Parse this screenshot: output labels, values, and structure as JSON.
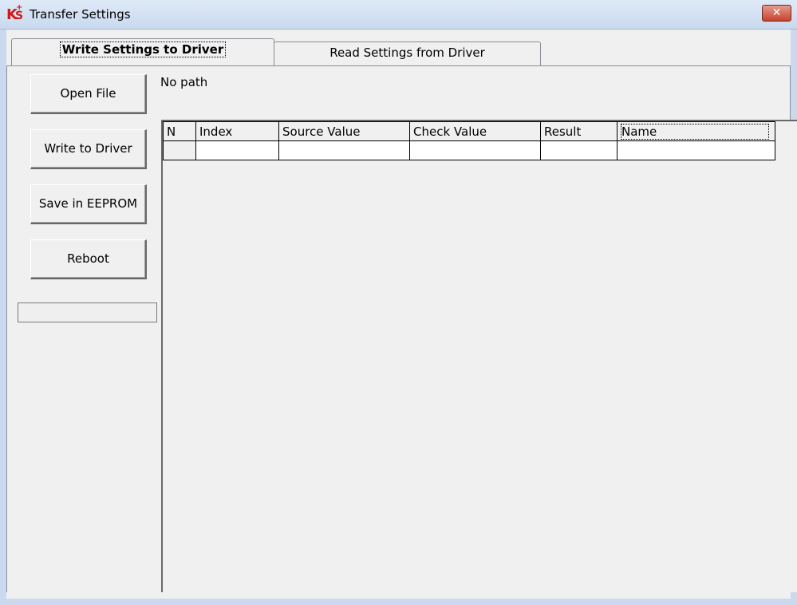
{
  "window": {
    "title": "Transfer Settings",
    "close_glyph": "✕"
  },
  "tabs": [
    {
      "label": "Write Settings to Driver",
      "active": true
    },
    {
      "label": "Read Settings from Driver",
      "active": false
    }
  ],
  "buttons": {
    "open_file": "Open File",
    "write_to_driver": "Write to Driver",
    "save_in_eeprom": "Save in EEPROM",
    "reboot": "Reboot"
  },
  "path_label": "No path",
  "progress": 0,
  "table": {
    "columns": [
      "N",
      "Index",
      "Source Value",
      "Check Value",
      "Result",
      "Name"
    ],
    "rows": [
      [
        "",
        "",
        "",
        "",
        "",
        ""
      ]
    ]
  },
  "icons": {
    "app": "ks-logo-icon",
    "close": "close-icon"
  }
}
